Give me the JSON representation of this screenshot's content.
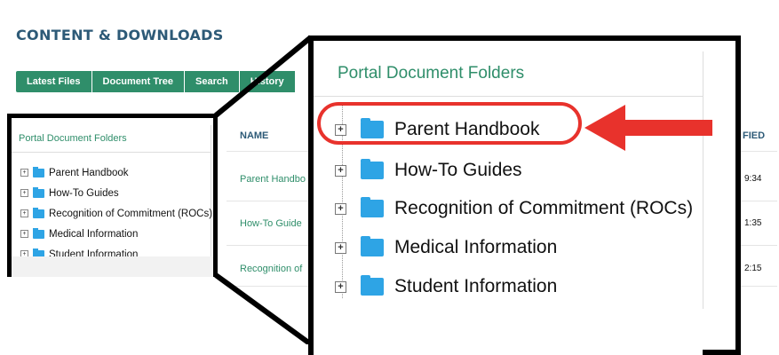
{
  "header": {
    "title": "CONTENT & DOWNLOADS"
  },
  "tabs": [
    "Latest Files",
    "Document Tree",
    "Search",
    "History"
  ],
  "left_panel": {
    "heading": "Portal Document Folders",
    "folders": [
      "Parent Handbook",
      "How-To Guides",
      "Recognition of Commitment (ROCs)",
      "Medical Information",
      "Student Information"
    ]
  },
  "table": {
    "name_header": "NAME",
    "modified_header": "FIED",
    "rows": [
      {
        "name": "Parent Handbo",
        "time": "9:34"
      },
      {
        "name": "How-To Guide",
        "time": "1:35"
      },
      {
        "name": "Recognition of",
        "time": "2:15"
      }
    ]
  },
  "zoom_panel": {
    "heading": "Portal Document Folders",
    "folders": [
      "Parent Handbook",
      "How-To Guides",
      "Recognition of Commitment (ROCs)",
      "Medical Information",
      "Student Information"
    ]
  },
  "colors": {
    "accent": "#2f8e6a",
    "title": "#2d5a77",
    "folder": "#2ea4e5",
    "highlight": "#e8322c"
  },
  "icons": {
    "expand": "plus-box-icon",
    "folder": "folder-icon",
    "arrow": "left-arrow-icon"
  }
}
